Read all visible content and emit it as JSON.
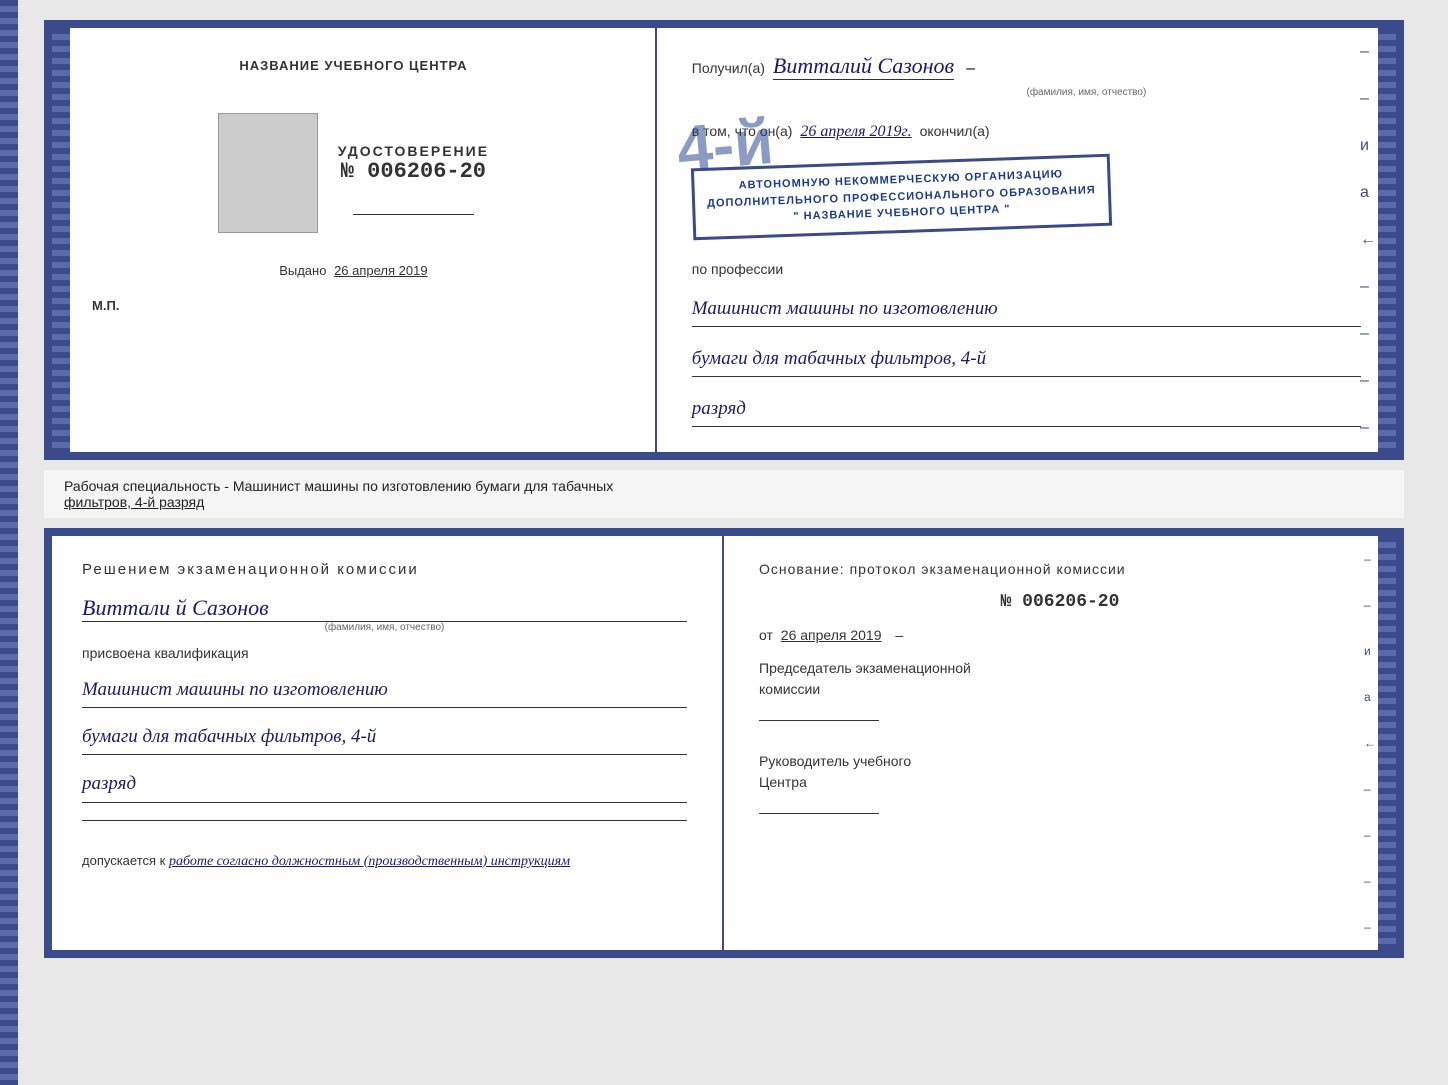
{
  "top_cert": {
    "left": {
      "title": "НАЗВАНИЕ УЧЕБНОГО ЦЕНТРА",
      "udostoverenie_label": "УДОСТОВЕРЕНИЕ",
      "udostoverenie_number": "№ 006206-20",
      "vydano_prefix": "Выдано",
      "vydano_date": "26 апреля 2019",
      "mp_label": "М.П."
    },
    "right": {
      "poluchil_prefix": "Получил(а)",
      "recipient_name": "Витталий Сазонов",
      "fio_label": "(фамилия, имя, отчество)",
      "vtom_prefix": "в том, что он(а)",
      "vtom_date": "26 апреля 2019г.",
      "okonchil_label": "окончил(а)",
      "stamp_line1": "АВТОНОМНУЮ НЕКОММЕРЧЕСКУЮ ОРГАНИЗАЦИЮ",
      "stamp_line2": "ДОПОЛНИТЕЛЬНОГО ПРОФЕССИОНАЛЬНОГО ОБРАЗОВАНИЯ",
      "stamp_line3": "\" НАЗВАНИЕ УЧЕБНОГО ЦЕНТРА \"",
      "po_professii": "по профессии",
      "profession_line1": "Машинист машины по изготовлению",
      "profession_line2": "бумаги для табачных фильтров, 4-й",
      "profession_line3": "разряд"
    }
  },
  "info_bar": {
    "text": "Рабочая специальность - Машинист машины по изготовлению бумаги для табачных",
    "text2": "фильтров, 4-й разряд"
  },
  "bottom_cert": {
    "left": {
      "resolution_title": "Решением  экзаменационной  комиссии",
      "person_name": "Виттали й Сазонов",
      "fio_label": "(фамилия, имя, отчество)",
      "prisvoyena_label": "присвоена квалификация",
      "qualification_line1": "Машинист машины по изготовлению",
      "qualification_line2": "бумаги для табачных фильтров, 4-й",
      "qualification_line3": "разряд",
      "dopuskaetsya_prefix": "допускается к",
      "dopuskaetsya_text": "работе согласно должностным (производственным) инструкциям"
    },
    "right": {
      "osnovaniye_title": "Основание:  протокол  экзаменационной  комиссии",
      "protocol_number": "№  006206-20",
      "ot_prefix": "от",
      "ot_date": "26 апреля 2019",
      "chairman_label": "Председатель экзаменационной\nкомиссии",
      "rukov_label": "Руководитель учебного\nЦентра"
    }
  },
  "big_stamp_number": "4-й",
  "side_chars": [
    "и",
    "а",
    "←",
    "–",
    "–",
    "–",
    "–"
  ]
}
